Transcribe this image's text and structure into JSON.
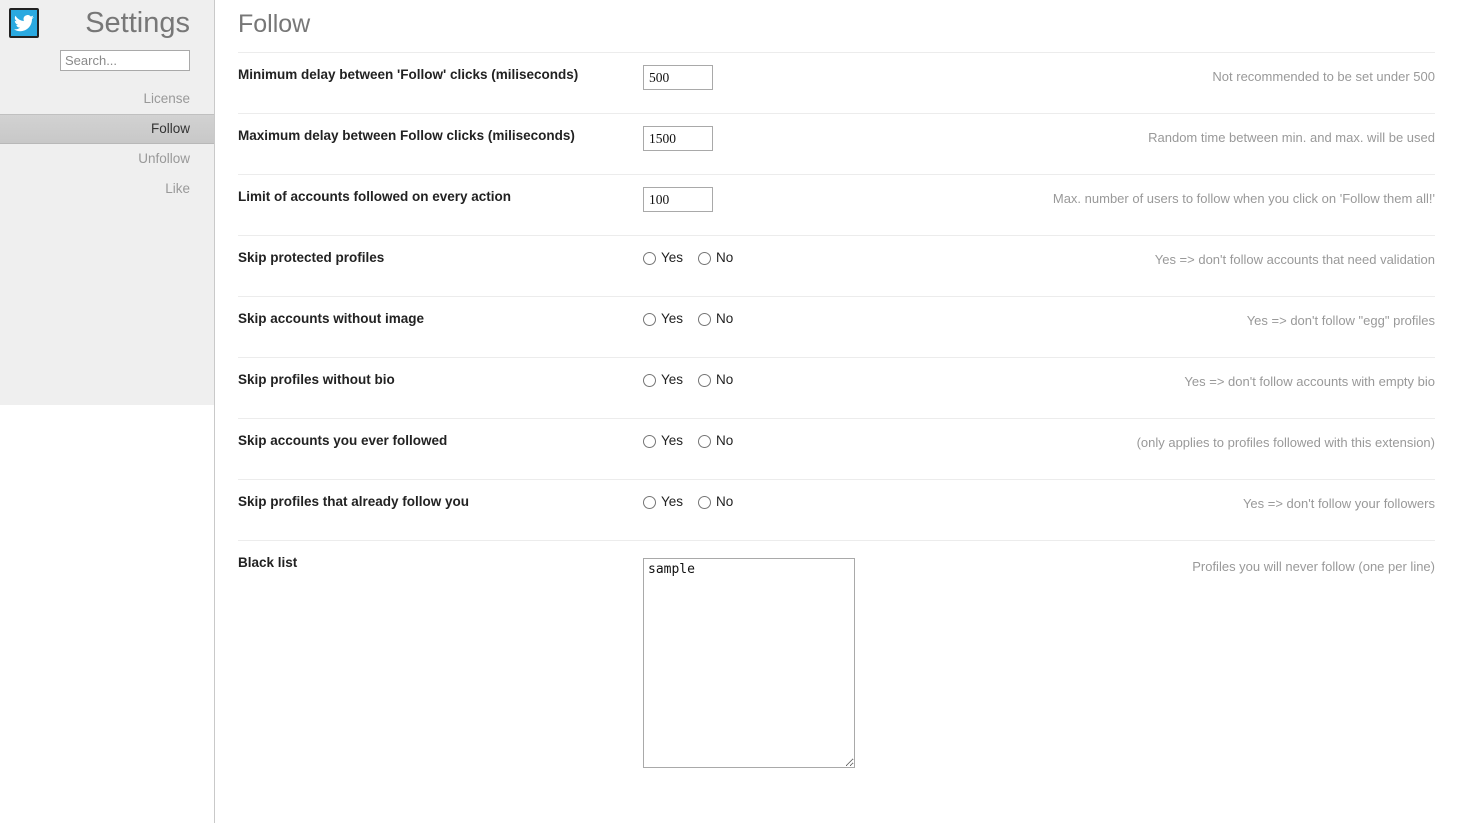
{
  "sidebar": {
    "brand_icon": "twitter-bird-icon",
    "title": "Settings",
    "search": {
      "value": "",
      "placeholder": "Search..."
    },
    "items": [
      {
        "label": "License",
        "active": false
      },
      {
        "label": "Follow",
        "active": true
      },
      {
        "label": "Unfollow",
        "active": false
      },
      {
        "label": "Like",
        "active": false
      }
    ]
  },
  "main": {
    "title": "Follow",
    "radio_yes_label": "Yes",
    "radio_no_label": "No",
    "rows": [
      {
        "label": "Minimum delay between 'Follow' clicks (miliseconds)",
        "type": "number",
        "value": "500",
        "hint": "Not recommended to be set under 500"
      },
      {
        "label": "Maximum delay between Follow clicks (miliseconds)",
        "type": "number",
        "value": "1500",
        "hint": "Random time between min. and max. will be used"
      },
      {
        "label": "Limit of accounts followed on every action",
        "type": "number",
        "value": "100",
        "hint": "Max. number of users to follow when you click on 'Follow them all!'"
      },
      {
        "label": "Skip protected profiles",
        "type": "radio",
        "value": "",
        "hint": "Yes => don't follow accounts that need validation"
      },
      {
        "label": "Skip accounts without image",
        "type": "radio",
        "value": "",
        "hint": "Yes => don't follow \"egg\" profiles"
      },
      {
        "label": "Skip profiles without bio",
        "type": "radio",
        "value": "",
        "hint": "Yes => don't follow accounts with empty bio"
      },
      {
        "label": "Skip accounts you ever followed",
        "type": "radio",
        "value": "",
        "hint": "(only applies to profiles followed with this extension)"
      },
      {
        "label": "Skip profiles that already follow you",
        "type": "radio",
        "value": "",
        "hint": "Yes => don't follow your followers"
      },
      {
        "label": "Black list",
        "type": "textarea",
        "value": "sample",
        "hint": "Profiles you will never follow (one per line)"
      }
    ]
  },
  "colors": {
    "brand_blue": "#2aa9e0",
    "sidebar_bg": "#efefef",
    "active_item_bg": "#cccccc",
    "hint_text": "#999999",
    "title_text": "#777777"
  }
}
